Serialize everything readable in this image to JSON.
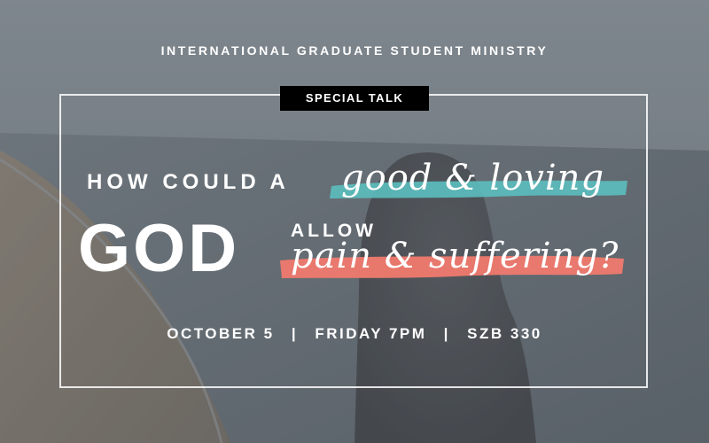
{
  "organization": "INTERNATIONAL GRADUATE STUDENT MINISTRY",
  "tag": "SPECIAL TALK",
  "headline": {
    "line1": "HOW COULD A",
    "script1": "good & loving",
    "god": "GOD",
    "allow": "ALLOW",
    "script2": "pain & suffering?"
  },
  "details": {
    "date": "OCTOBER 5",
    "time": "FRIDAY 7PM",
    "location": "SZB 330",
    "separator": "|"
  },
  "colors": {
    "teal_brush": "#5bbcbc",
    "coral_brush": "#f07a6e",
    "tag_bg": "#000000",
    "text": "#ffffff"
  }
}
